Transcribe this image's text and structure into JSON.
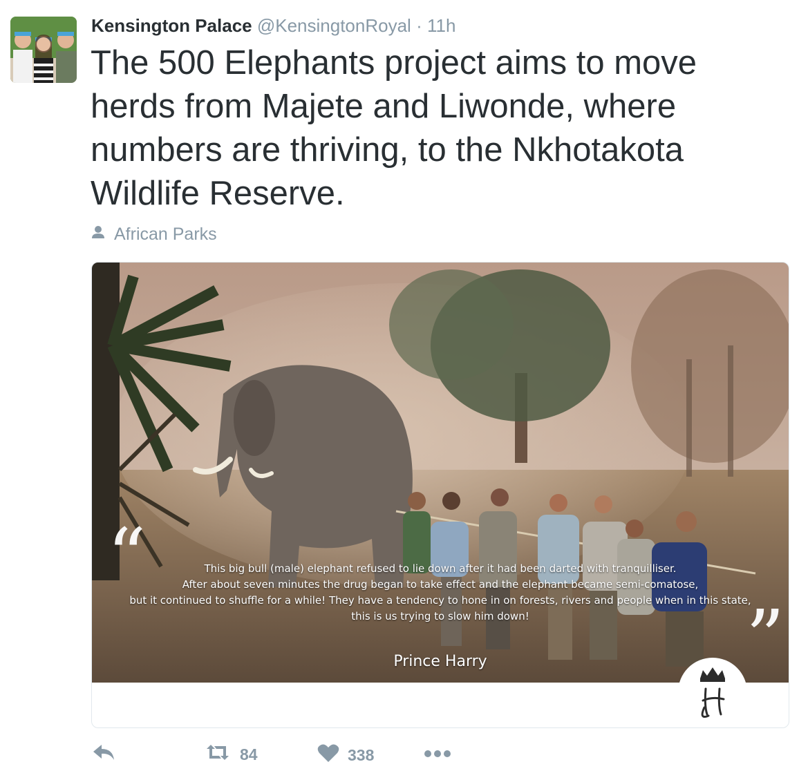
{
  "tweet": {
    "author_name": "Kensington Palace",
    "handle": "@KensingtonRoyal",
    "separator": "·",
    "time": "11h",
    "text": "The 500 Elephants project aims to move herds from Majete and Liwonde, where numbers are thriving, to the Nkhotakota Wildlife Reserve.",
    "attribution": "African Parks"
  },
  "card": {
    "quote_lines": [
      "This big bull (male) elephant refused to lie down after it had been darted with tranquilliser.",
      "After about seven minutes the drug began to take effect and the elephant became semi-comatose,",
      "but it continued to shuffle for a while! They have a tendency to hone in on forests, rivers and people when in this state,",
      "this is us trying to slow him down!"
    ],
    "quote_author": "Prince Harry",
    "quote_open": "“",
    "quote_close": "”"
  },
  "actions": {
    "retweet_count": "84",
    "like_count": "338"
  },
  "colors": {
    "text": "#292f33",
    "secondary": "#8899a6",
    "border": "#e1e8ed"
  },
  "icons": [
    "reply-icon",
    "retweet-icon",
    "heart-icon",
    "more-icon",
    "person-icon",
    "crest-icon"
  ]
}
